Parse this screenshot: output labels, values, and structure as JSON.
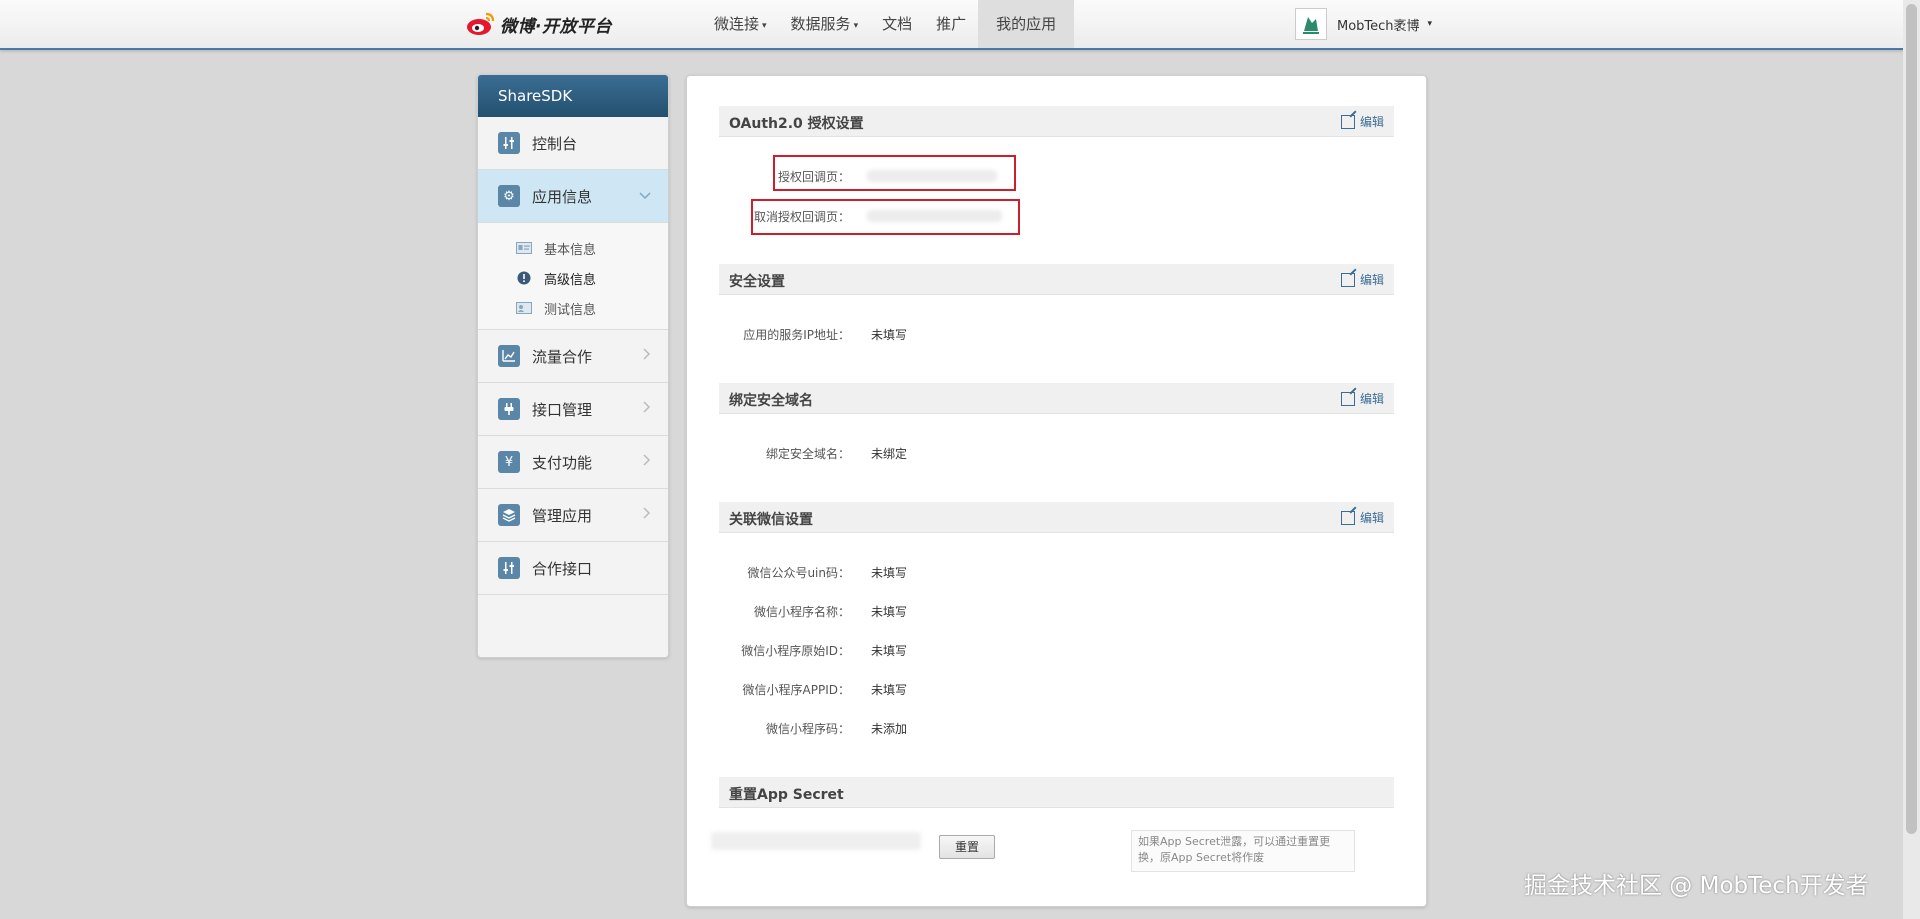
{
  "brand": {
    "logo_text": "微博·开放平台"
  },
  "nav": {
    "items": [
      {
        "label": "微连接",
        "caret": "▾"
      },
      {
        "label": "数据服务",
        "caret": "▾"
      },
      {
        "label": "文档",
        "caret": ""
      },
      {
        "label": "推广",
        "caret": ""
      },
      {
        "label": "我的应用",
        "caret": ""
      }
    ],
    "active_index": 4
  },
  "user": {
    "name": "MobTech袤博",
    "caret": "▾"
  },
  "sidebar": {
    "title": "ShareSDK",
    "items": [
      {
        "label": "控制台",
        "icon": "sliders-icon"
      },
      {
        "label": "应用信息",
        "icon": "gear-icon",
        "expanded": true
      },
      {
        "label": "流量合作",
        "icon": "chart-icon"
      },
      {
        "label": "接口管理",
        "icon": "plug-icon"
      },
      {
        "label": "支付功能",
        "icon": "yen-icon"
      },
      {
        "label": "管理应用",
        "icon": "layers-icon"
      },
      {
        "label": "合作接口",
        "icon": "sliders-icon"
      }
    ],
    "sub_items": [
      {
        "label": "基本信息",
        "icon": "id-card-icon"
      },
      {
        "label": "高级信息",
        "icon": "alert-icon"
      },
      {
        "label": "测试信息",
        "icon": "test-card-icon"
      }
    ],
    "active_sub_index": 1
  },
  "sections": {
    "edit_label": "编辑",
    "oauth": {
      "title": "OAuth2.0 授权设置",
      "rows": [
        {
          "label": "授权回调页："
        },
        {
          "label": "取消授权回调页："
        }
      ]
    },
    "security": {
      "title": "安全设置",
      "rows": [
        {
          "label": "应用的服务IP地址：",
          "value": "未填写"
        }
      ]
    },
    "domain": {
      "title": "绑定安全域名",
      "rows": [
        {
          "label": "绑定安全域名：",
          "value": "未绑定"
        }
      ]
    },
    "wechat": {
      "title": "关联微信设置",
      "rows": [
        {
          "label": "微信公众号uin码：",
          "value": "未填写"
        },
        {
          "label": "微信小程序名称：",
          "value": "未填写"
        },
        {
          "label": "微信小程序原始ID：",
          "value": "未填写"
        },
        {
          "label": "微信小程序APPID：",
          "value": "未填写"
        },
        {
          "label": "微信小程序码：",
          "value": "未添加"
        }
      ]
    },
    "reset": {
      "title": "重置App Secret",
      "button": "重置",
      "note": "如果App Secret泄露，可以通过重置更换，原App Secret将作废"
    }
  },
  "watermark": "掘金技术社区 @ MobTech开发者"
}
